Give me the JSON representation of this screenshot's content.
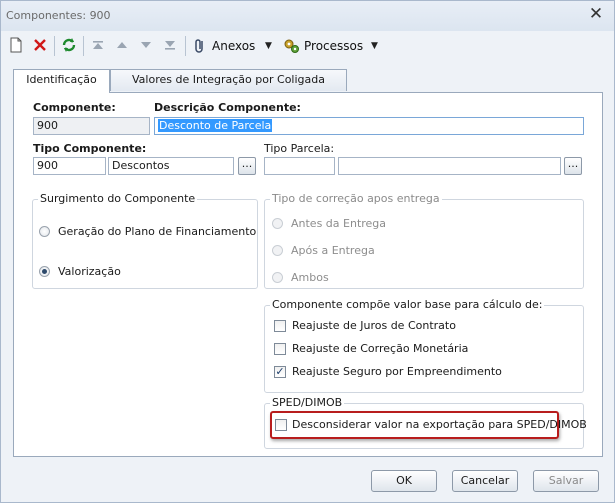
{
  "window": {
    "title": "Componentes: 900",
    "close_glyph": "✕"
  },
  "toolbar": {
    "icons": [
      "new-document-icon",
      "delete-x-icon",
      "refresh-icon",
      "first-record-icon",
      "previous-record-icon",
      "next-record-icon",
      "last-record-icon",
      "attachment-icon",
      "processes-gear-icon"
    ],
    "anexos_label": "Anexos",
    "processos_label": "Processos",
    "dropdown_arrow": "▼"
  },
  "tabs": [
    {
      "label": "Identificação",
      "active": true
    },
    {
      "label": "Valores de Integração por Coligada",
      "active": false
    }
  ],
  "form": {
    "componente_label": "Componente:",
    "componente_value": "900",
    "descricao_label": "Descrição Componente:",
    "descricao_value": "Desconto de Parcela",
    "tipo_componente_label": "Tipo Componente:",
    "tipo_componente_code": "900",
    "tipo_componente_desc": "Descontos",
    "tipo_parcela_label": "Tipo Parcela:",
    "tipo_parcela_code": "",
    "tipo_parcela_desc": "",
    "lookup_glyph": "..."
  },
  "surgimento": {
    "legend": "Surgimento do Componente",
    "options": [
      {
        "label": "Geração do Plano de Financiamento",
        "selected": false
      },
      {
        "label": "Valorização",
        "selected": true
      }
    ]
  },
  "correcao": {
    "legend": "Tipo de correção apos entrega",
    "options": [
      {
        "label": "Antes da Entrega",
        "selected": false
      },
      {
        "label": "Após a Entrega",
        "selected": false
      },
      {
        "label": "Ambos",
        "selected": false
      }
    ]
  },
  "base_calculo": {
    "legend": "Componente compõe valor base para cálculo de:",
    "options": [
      {
        "label": "Reajuste de Juros de Contrato",
        "checked": false
      },
      {
        "label": "Reajuste de Correção Monetária",
        "checked": false
      },
      {
        "label": "Reajuste Seguro por Empreendimento",
        "checked": true
      }
    ]
  },
  "sped": {
    "legend": "SPED/DIMOB",
    "option_label": "Desconsiderar valor na exportação para SPED/DIMOB",
    "checked": false
  },
  "footer": {
    "ok": "OK",
    "cancelar": "Cancelar",
    "salvar": "Salvar"
  },
  "colors": {
    "highlight": "#b81d1d",
    "selection": "#3399ff",
    "panel_border": "#9aa9bc"
  }
}
